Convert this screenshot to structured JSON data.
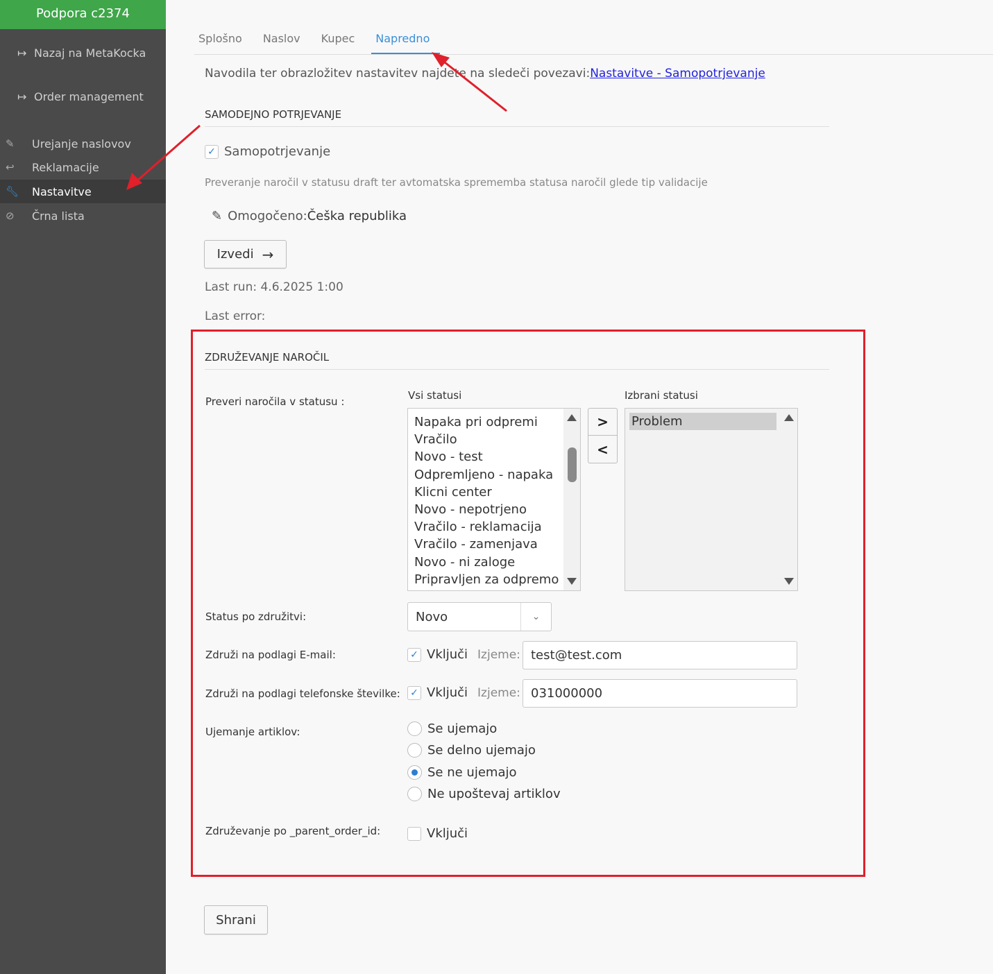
{
  "sidebar": {
    "brand": "Podpora c2374",
    "back_link": "Nazaj na MetaKocka",
    "order_link": "Order management",
    "items": [
      {
        "label": "Urejanje naslovov",
        "icon": "edit-icon"
      },
      {
        "label": "Reklamacije",
        "icon": "reply-icon"
      },
      {
        "label": "Nastavitve",
        "icon": "wrench-icon",
        "active": true
      },
      {
        "label": "Črna lista",
        "icon": "ban-icon"
      }
    ]
  },
  "tabs": [
    "Splošno",
    "Naslov",
    "Kupec",
    "Napredno"
  ],
  "active_tab": "Napredno",
  "info": {
    "text": "Navodila ter obrazložitev nastavitev najdete na sledeči povezavi:",
    "link": "Nastavitve - Samopotrjevanje"
  },
  "auto_confirm": {
    "title": "SAMODEJNO POTRJEVANJE",
    "checkbox_label": "Samopotrjevanje",
    "checked": true,
    "description": "Preveranje naročil v statusu draft ter avtomatska sprememba statusa naročil glede tip validacije",
    "enabled_label": "Omogočeno:",
    "enabled_value": "Češka republika",
    "run_button": "Izvedi",
    "last_run": "Last run: 4.6.2025 1:00",
    "last_error": "Last error:"
  },
  "merge": {
    "title": "ZDRUŽEVANJE NAROČIL",
    "check_status_label": "Preveri naročila v statusu :",
    "all_statuses_label": "Vsi statusi",
    "selected_statuses_label": "Izbrani statusi",
    "all_statuses": [
      "Napaka pri odpremi",
      "Vračilo",
      "Novo - test",
      "Odpremljeno - napaka",
      "Klicni center",
      "Novo - nepotrjeno",
      "Vračilo - reklamacija",
      "Vračilo - zamenjava",
      "Novo - ni zaloge",
      "Pripravljen za odpremo - r"
    ],
    "selected_statuses": [
      "Problem"
    ],
    "status_after_label": "Status po združitvi:",
    "status_after_value": "Novo",
    "email_label": "Združi na podlagi E-mail:",
    "email_include": "Vključi",
    "email_checked": true,
    "email_except_label": "Izjeme:",
    "email_except_value": "test@test.com",
    "phone_label": "Združi na podlagi telefonske številke:",
    "phone_include": "Vključi",
    "phone_checked": true,
    "phone_except_label": "Izjeme:",
    "phone_except_value": "031000000",
    "items_label": "Ujemanje artiklov:",
    "items_options": [
      "Se ujemajo",
      "Se delno ujemajo",
      "Se ne ujemajo",
      "Ne upoštevaj artiklov"
    ],
    "items_selected": "Se ne ujemajo",
    "parent_label": "Združevanje po _parent_order_id:",
    "parent_include": "Vključi",
    "parent_checked": false
  },
  "save_button": "Shrani",
  "colors": {
    "brand": "#3fa64a",
    "accent": "#3a8fd8",
    "highlight": "#e0202a",
    "sidebar": "#4a4a4a"
  }
}
